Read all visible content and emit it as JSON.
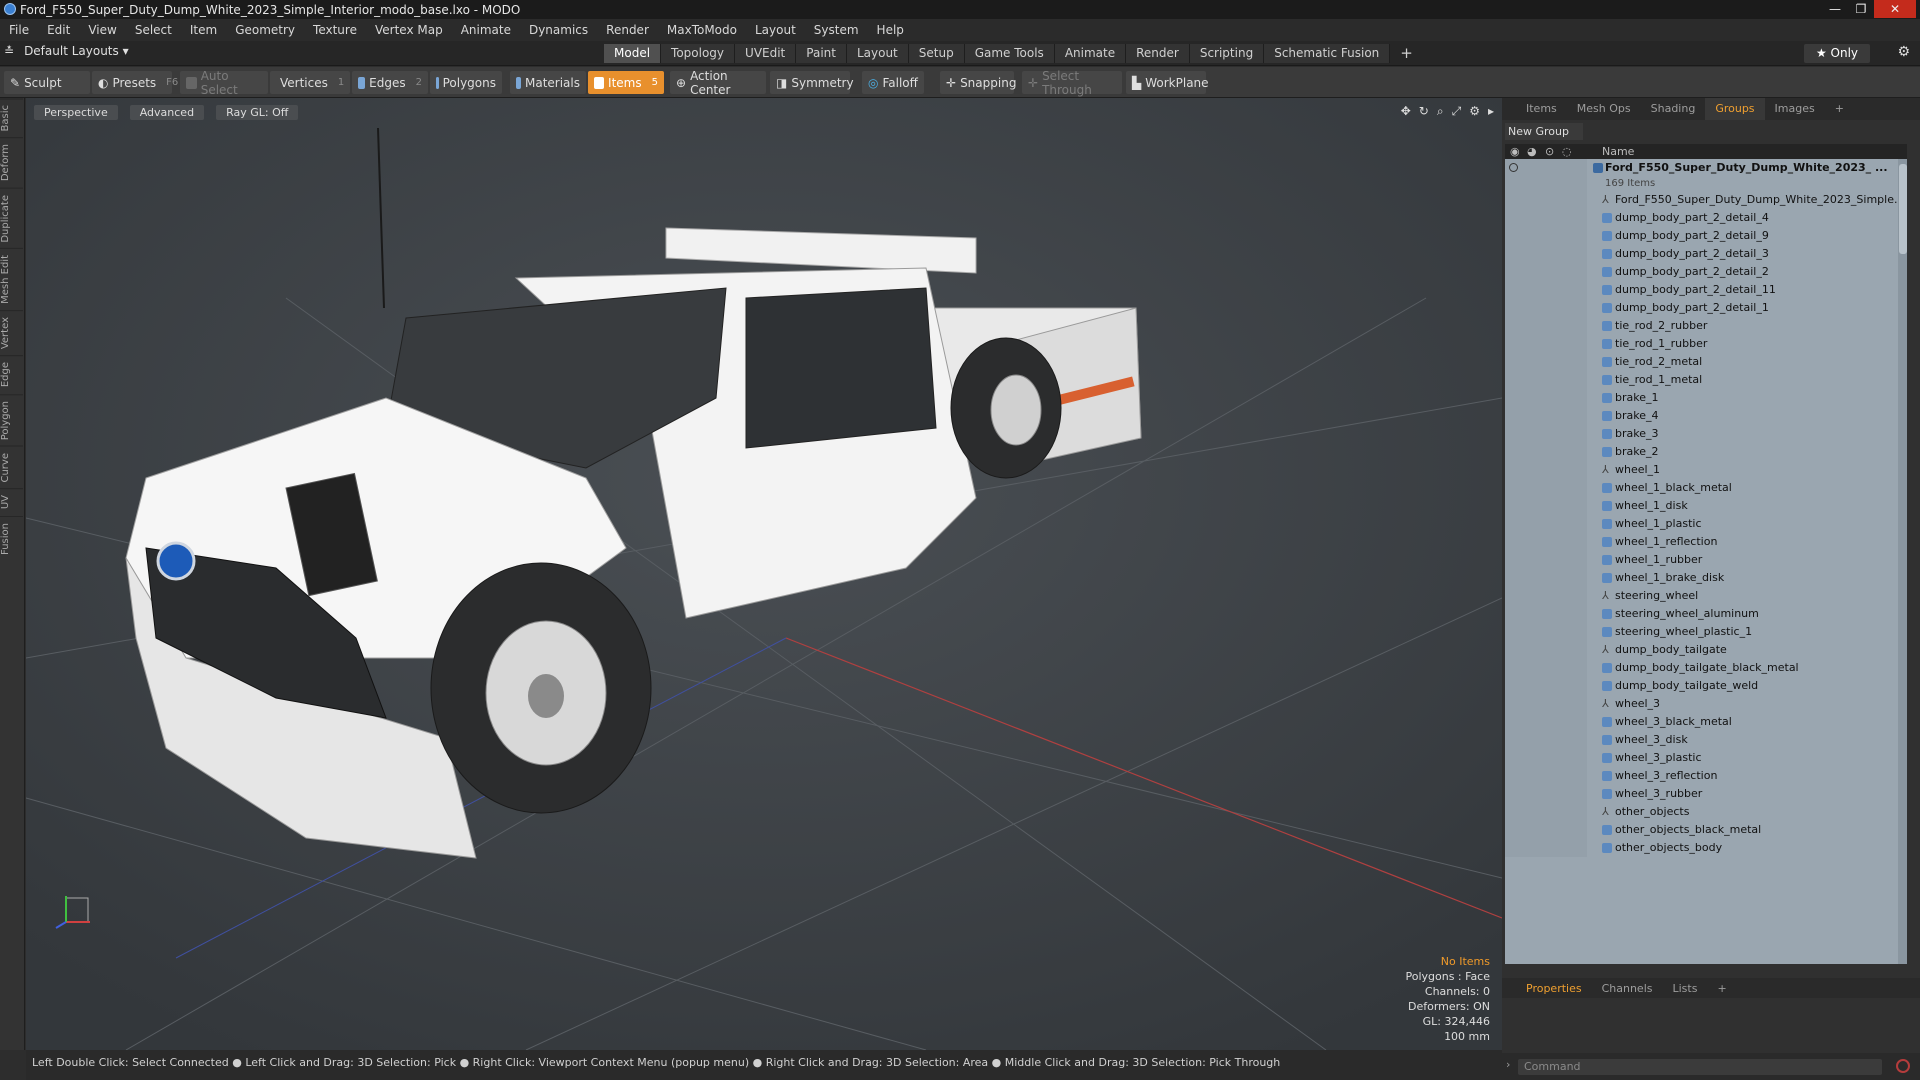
{
  "window": {
    "title": "Ford_F550_Super_Duty_Dump_White_2023_Simple_Interior_modo_base.lxo - MODO",
    "controls": [
      "—",
      "❐",
      "✕"
    ]
  },
  "menu": [
    "File",
    "Edit",
    "View",
    "Select",
    "Item",
    "Geometry",
    "Texture",
    "Vertex Map",
    "Animate",
    "Dynamics",
    "Render",
    "MaxToModo",
    "Layout",
    "System",
    "Help"
  ],
  "layoutbar": {
    "layouts": "Default Layouts ▾",
    "tabs": [
      "Model",
      "Topology",
      "UVEdit",
      "Paint",
      "Layout",
      "Setup",
      "Game Tools",
      "Animate",
      "Render",
      "Scripting",
      "Schematic Fusion"
    ],
    "active_tab": "Model",
    "only": "★ Only"
  },
  "toolbar": {
    "sculpt": "Sculpt",
    "presets": "Presets",
    "presets_key": "F6",
    "auto_select": "Auto Select",
    "vertices": "Vertices",
    "vertices_key": "1",
    "edges": "Edges",
    "edges_key": "2",
    "polygons": "Polygons",
    "materials": "Materials",
    "items": "Items",
    "items_key": "5",
    "action_center": "Action Center",
    "symmetry": "Symmetry",
    "falloff": "Falloff",
    "snapping": "Snapping",
    "select_through": "Select Through",
    "workplane": "WorkPlane"
  },
  "left_tabs": [
    "Basic",
    "Deform",
    "Duplicate",
    "Mesh Edit",
    "Vertex",
    "Edge",
    "Polygon",
    "Curve",
    "UV",
    "Fusion"
  ],
  "viewport": {
    "view": "Perspective",
    "shading": "Advanced",
    "raygl": "Ray GL: Off",
    "info": {
      "selection": "No Items",
      "polygons": "Polygons : Face",
      "channels": "Channels: 0",
      "deformers": "Deformers: ON",
      "gl": "GL: 324,446",
      "scale": "100 mm"
    }
  },
  "status": "Left Double Click: Select Connected ● Left Click and Drag: 3D Selection: Pick ● Right Click: Viewport Context Menu (popup menu) ● Right Click and Drag: 3D Selection: Area ● Middle Click and Drag: 3D Selection: Pick Through",
  "panel_tabs": [
    "Items",
    "Mesh Ops",
    "Shading",
    "Groups",
    "Images"
  ],
  "panel_active": "Groups",
  "new_group": "New Group",
  "col_name": "Name",
  "group_root": "Ford_F550_Super_Duty_Dump_White_2023_ ...",
  "group_count": "169 Items",
  "tree_items": [
    {
      "name": "Ford_F550_Super_Duty_Dump_White_2023_Simple...",
      "type": "locator"
    },
    {
      "name": "dump_body_part_2_detail_4",
      "type": "mesh"
    },
    {
      "name": "dump_body_part_2_detail_9",
      "type": "mesh"
    },
    {
      "name": "dump_body_part_2_detail_3",
      "type": "mesh"
    },
    {
      "name": "dump_body_part_2_detail_2",
      "type": "mesh"
    },
    {
      "name": "dump_body_part_2_detail_11",
      "type": "mesh"
    },
    {
      "name": "dump_body_part_2_detail_1",
      "type": "mesh"
    },
    {
      "name": "tie_rod_2_rubber",
      "type": "mesh"
    },
    {
      "name": "tie_rod_1_rubber",
      "type": "mesh"
    },
    {
      "name": "tie_rod_2_metal",
      "type": "mesh"
    },
    {
      "name": "tie_rod_1_metal",
      "type": "mesh"
    },
    {
      "name": "brake_1",
      "type": "mesh"
    },
    {
      "name": "brake_4",
      "type": "mesh"
    },
    {
      "name": "brake_3",
      "type": "mesh"
    },
    {
      "name": "brake_2",
      "type": "mesh"
    },
    {
      "name": "wheel_1",
      "type": "locator"
    },
    {
      "name": "wheel_1_black_metal",
      "type": "mesh"
    },
    {
      "name": "wheel_1_disk",
      "type": "mesh"
    },
    {
      "name": "wheel_1_plastic",
      "type": "mesh"
    },
    {
      "name": "wheel_1_reflection",
      "type": "mesh"
    },
    {
      "name": "wheel_1_rubber",
      "type": "mesh"
    },
    {
      "name": "wheel_1_brake_disk",
      "type": "mesh"
    },
    {
      "name": "steering_wheel",
      "type": "locator"
    },
    {
      "name": "steering_wheel_aluminum",
      "type": "mesh"
    },
    {
      "name": "steering_wheel_plastic_1",
      "type": "mesh"
    },
    {
      "name": "dump_body_tailgate",
      "type": "locator"
    },
    {
      "name": "dump_body_tailgate_black_metal",
      "type": "mesh"
    },
    {
      "name": "dump_body_tailgate_weld",
      "type": "mesh"
    },
    {
      "name": "wheel_3",
      "type": "locator"
    },
    {
      "name": "wheel_3_black_metal",
      "type": "mesh"
    },
    {
      "name": "wheel_3_disk",
      "type": "mesh"
    },
    {
      "name": "wheel_3_plastic",
      "type": "mesh"
    },
    {
      "name": "wheel_3_reflection",
      "type": "mesh"
    },
    {
      "name": "wheel_3_rubber",
      "type": "mesh"
    },
    {
      "name": "other_objects",
      "type": "locator"
    },
    {
      "name": "other_objects_black_metal",
      "type": "mesh"
    },
    {
      "name": "other_objects_body",
      "type": "mesh"
    }
  ],
  "props_tabs": [
    "Properties",
    "Channels",
    "Lists"
  ],
  "props_active": "Properties",
  "command_placeholder": "Command",
  "colors": {
    "accent": "#e8902d",
    "tree_bg": "#9aa6b0",
    "viewport_bg": "#3f4347"
  }
}
